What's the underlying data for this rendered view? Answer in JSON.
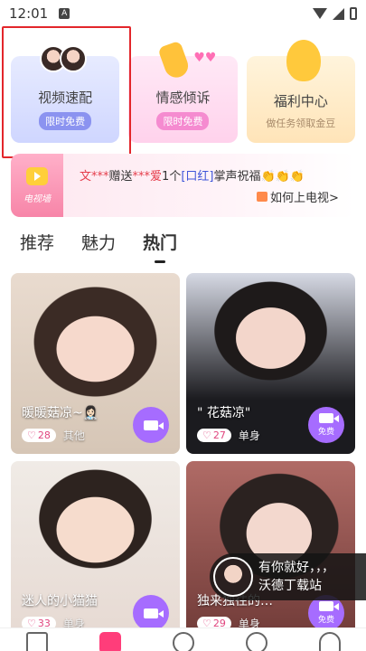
{
  "status_bar": {
    "time": "12:01",
    "indicator": "A"
  },
  "features": [
    {
      "title": "视频速配",
      "badge": "限时免费"
    },
    {
      "title": "情感倾诉",
      "badge": "限时免费"
    },
    {
      "title": "福利中心",
      "subtitle": "做任务领取金豆"
    }
  ],
  "tv_banner": {
    "logo_label": "电视墙",
    "sender": "文***",
    "verb": "赠送",
    "receiver": "***爱",
    "gift_count": "1个",
    "gift_name": "[口红]",
    "gift_suffix": "掌声祝福👏👏👏",
    "how_link": "如何上电视>"
  },
  "tabs": [
    "推荐",
    "魅力",
    "热门"
  ],
  "active_tab": "热门",
  "cards": [
    {
      "name": "暖暖菇凉~👩🏻‍⚕️",
      "likes": "28",
      "status": "其他",
      "free": ""
    },
    {
      "name": "\" 花菇凉\"",
      "likes": "27",
      "status": "单身",
      "free": "免费"
    },
    {
      "name": "迷人的小猫猫",
      "likes": "33",
      "status": "单身",
      "free": ""
    },
    {
      "name": "独来独往的…",
      "likes": "29",
      "status": "单身",
      "free": "免费"
    }
  ],
  "toast": {
    "line1": "有你就好，，，",
    "line2": "沃德丁载站"
  },
  "colors": {
    "accent_purple": "#a66cff",
    "live_pink": "#ff3d7a",
    "highlight_red": "#e3262b"
  }
}
